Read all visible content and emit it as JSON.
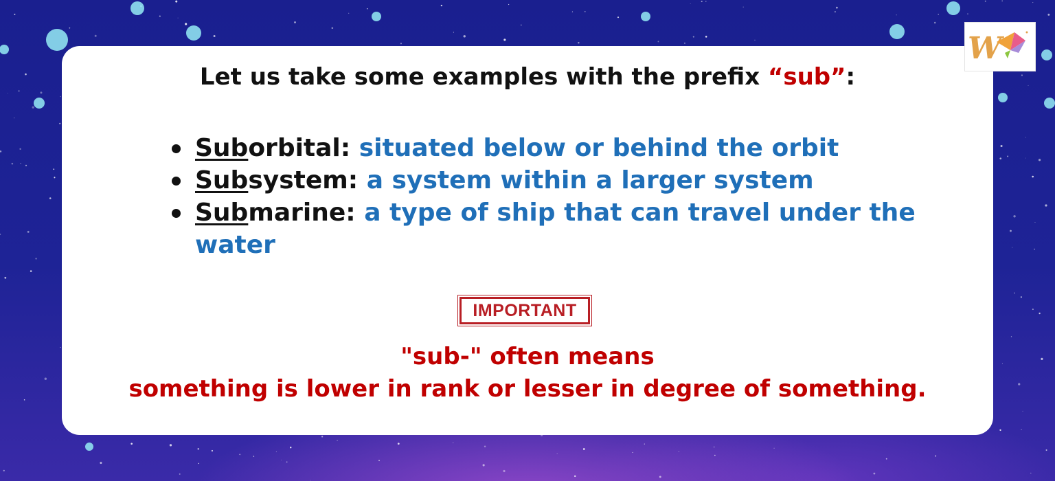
{
  "heading": {
    "before": "Let us take some examples with the prefix ",
    "prefix": "“sub”",
    "after": ":"
  },
  "examples": [
    {
      "root": "Sub",
      "rest": "orbital",
      "sep": ": ",
      "definition": "situated below or behind the orbit"
    },
    {
      "root": "Sub",
      "rest": "system",
      "sep": ": ",
      "definition": "a system within a larger system"
    },
    {
      "root": "Sub",
      "rest": "marine",
      "sep": ": ",
      "definition": "a type of ship that can travel under the water"
    }
  ],
  "stamp_text": "IMPORTANT",
  "note": {
    "line1": "\"sub-\" often means",
    "line2": "something is lower in rank or lesser in degree of something."
  },
  "colors": {
    "background": "#1b1f8c",
    "card": "#ffffff",
    "definition": "#1f6fb8",
    "accent_red": "#c00000",
    "stamp": "#b81e24"
  }
}
